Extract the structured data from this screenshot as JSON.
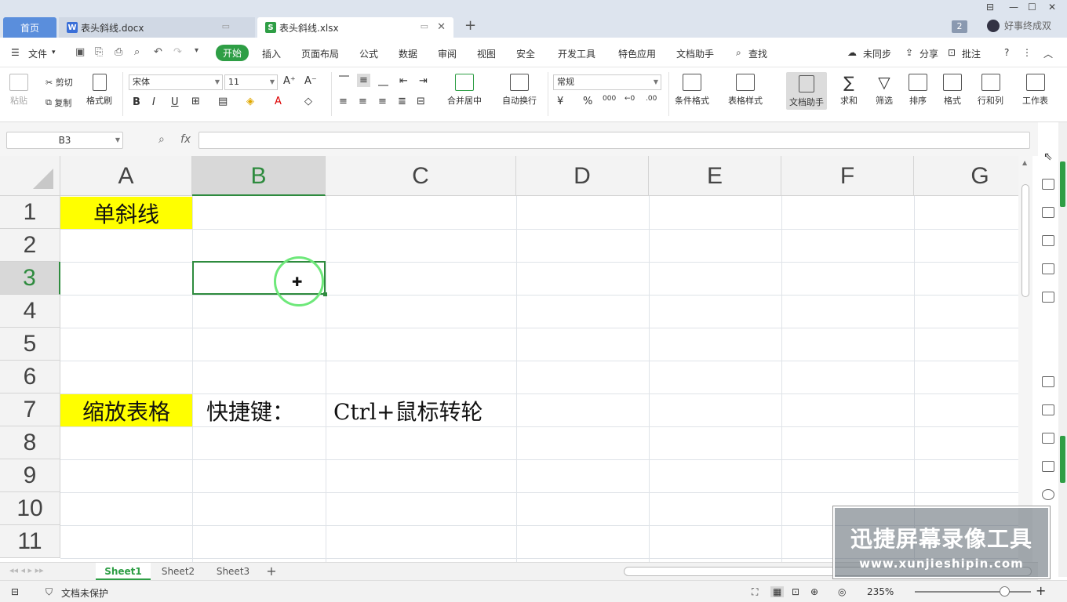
{
  "tabs": {
    "home": "首页",
    "doc": "表头斜线.docx",
    "xls": "表头斜线.xlsx",
    "new": "+"
  },
  "title_right": {
    "badge": "2",
    "user": "好事终成双"
  },
  "menu": {
    "file": "文件",
    "items": [
      "开始",
      "插入",
      "页面布局",
      "公式",
      "数据",
      "审阅",
      "视图",
      "安全",
      "开发工具",
      "特色应用",
      "文档助手"
    ],
    "search": "查找",
    "sync": "未同步",
    "share": "分享",
    "comment": "批注"
  },
  "ribbon": {
    "paste": "粘贴",
    "cut": "剪切",
    "copy": "复制",
    "format_painter": "格式刷",
    "font_name": "宋体",
    "font_size": "11",
    "merge_center": "合并居中",
    "auto_wrap": "自动换行",
    "number_format": "常规",
    "percent": "%",
    "thousands": "000",
    "cond_format": "条件格式",
    "table_style": "表格样式",
    "doc_helper": "文档助手",
    "sum": "求和",
    "filter": "筛选",
    "sort": "排序",
    "format": "格式",
    "row_col": "行和列",
    "worksheet": "工作表"
  },
  "formula_bar": {
    "cell_ref": "B3",
    "fx": "fx",
    "content": ""
  },
  "grid": {
    "columns": [
      "A",
      "B",
      "C",
      "D",
      "E",
      "F",
      "G"
    ],
    "rows": [
      "1",
      "2",
      "3",
      "4",
      "5",
      "6",
      "7",
      "8",
      "9",
      "10",
      "11"
    ],
    "selected_cell": "B3",
    "cells": {
      "A1": "单斜线",
      "A7": "缩放表格",
      "B7": "快捷键：",
      "C7": "Ctrl+鼠标转轮"
    },
    "highlight_color": "#ffff00",
    "accent_color": "#2e8b3e"
  },
  "sheets": [
    "Sheet1",
    "Sheet2",
    "Sheet3"
  ],
  "add_sheet": "+",
  "status": {
    "protect": "文档未保护",
    "zoom": "235%"
  },
  "watermark": {
    "title": "迅捷屏幕录像工具",
    "url": "www.xunjieshipin.com"
  }
}
